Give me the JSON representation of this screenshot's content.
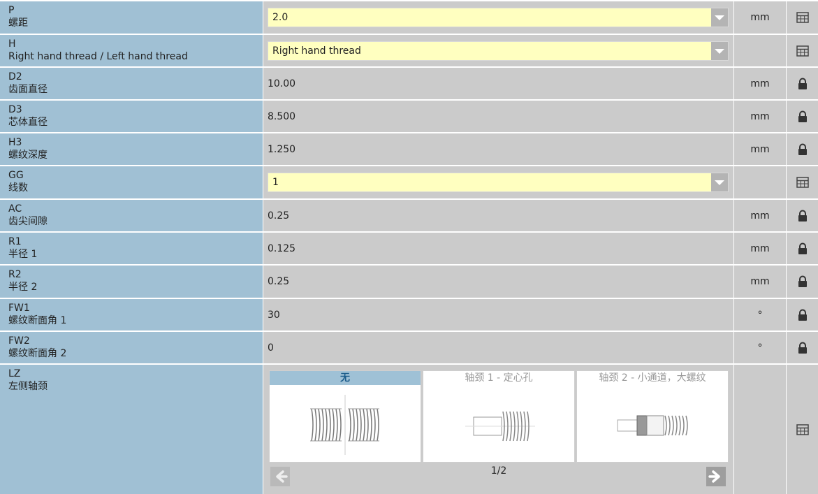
{
  "rows": [
    {
      "code": "P",
      "desc": "螺距",
      "type": "select",
      "value": "2.0",
      "unit": "mm",
      "action": "table-icon"
    },
    {
      "code": "H",
      "desc": "Right hand thread / Left hand thread",
      "type": "select",
      "value": "Right hand thread",
      "unit": "",
      "action": "table-icon"
    },
    {
      "code": "D2",
      "desc": "齿面直径",
      "type": "text",
      "value": "10.00",
      "unit": "mm",
      "action": "lock-icon"
    },
    {
      "code": "D3",
      "desc": "芯体直径",
      "type": "text",
      "value": "8.500",
      "unit": "mm",
      "action": "lock-icon"
    },
    {
      "code": "H3",
      "desc": "螺纹深度",
      "type": "text",
      "value": "1.250",
      "unit": "mm",
      "action": "lock-icon"
    },
    {
      "code": "GG",
      "desc": "线数",
      "type": "select",
      "value": "1",
      "unit": "",
      "action": "table-icon"
    },
    {
      "code": "AC",
      "desc": "齿尖间隙",
      "type": "text",
      "value": "0.25",
      "unit": "mm",
      "action": "lock-icon"
    },
    {
      "code": "R1",
      "desc": "半径 1",
      "type": "text",
      "value": "0.125",
      "unit": "mm",
      "action": "lock-icon"
    },
    {
      "code": "R2",
      "desc": "半径 2",
      "type": "text",
      "value": "0.25",
      "unit": "mm",
      "action": "lock-icon"
    },
    {
      "code": "FW1",
      "desc": "螺纹断面角 1",
      "type": "text",
      "value": "30",
      "unit": "°",
      "action": "lock-icon"
    },
    {
      "code": "FW2",
      "desc": "螺纹断面角 2",
      "type": "text",
      "value": "0",
      "unit": "°",
      "action": "lock-icon"
    }
  ],
  "lz": {
    "code": "LZ",
    "desc": "左侧轴颈",
    "options": [
      {
        "label": "无",
        "active": true,
        "icon": "thread-none-thumbnail"
      },
      {
        "label": "轴颈 1 - 定心孔",
        "active": false,
        "icon": "thread-journal-1-thumbnail"
      },
      {
        "label": "轴颈 2 - 小通道，大螺纹",
        "active": false,
        "icon": "thread-journal-2-thumbnail"
      }
    ],
    "page": "1/2",
    "prev_icon": "arrow-left-icon",
    "next_icon": "arrow-right-icon",
    "action": "table-icon"
  },
  "colors": {
    "label_bg": "#a0c0d4",
    "value_bg": "#cbcbcb",
    "select_bg": "#ffffc0",
    "active_tab": "#9fc1d6"
  }
}
